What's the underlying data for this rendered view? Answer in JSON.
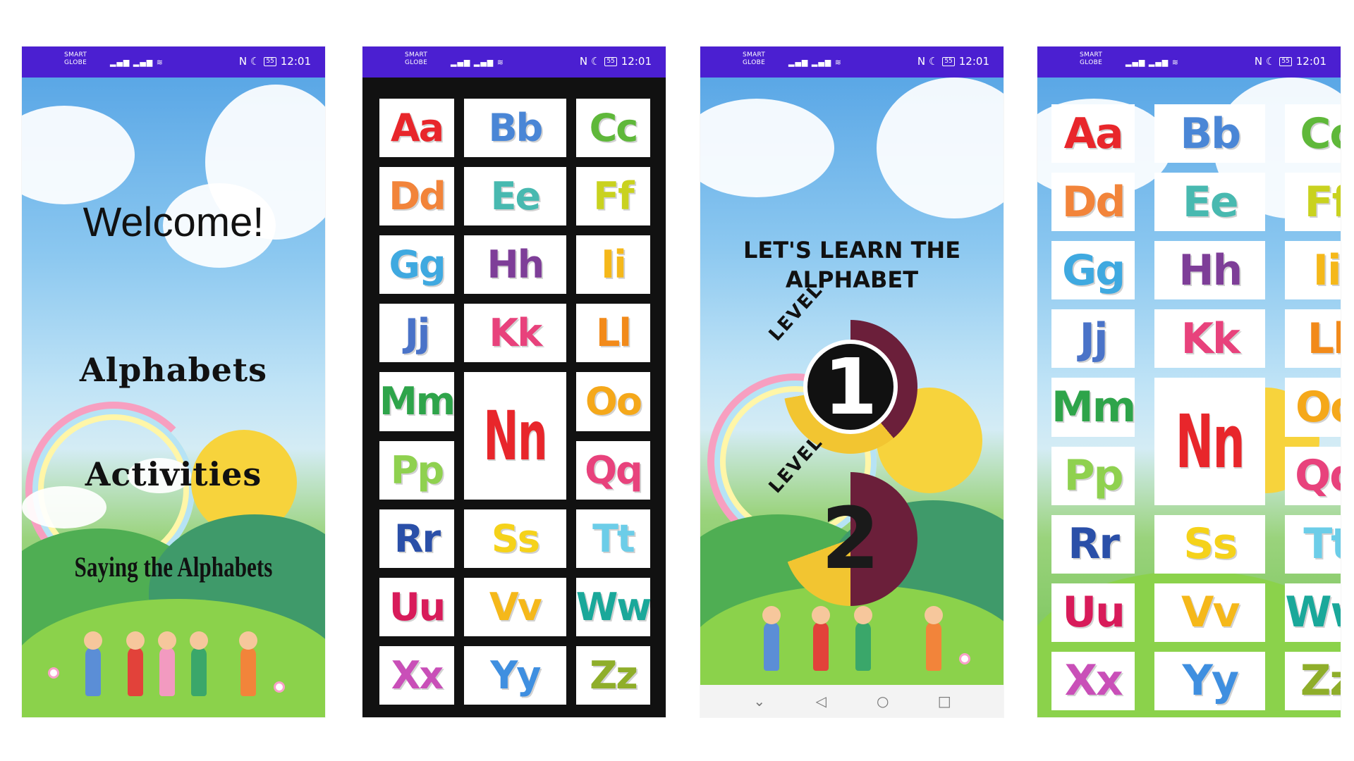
{
  "status_bar": {
    "carrier_line1": "SMART",
    "carrier_line2": "GLOBE",
    "signal": "▂▄▆ ▂▄▆ ≋",
    "icons": "N ☾",
    "battery": "55",
    "time": "12:01"
  },
  "screen1": {
    "welcome": "Welcome!",
    "menu": [
      "Alphabets",
      "Activities",
      "Saying the Alphabets"
    ]
  },
  "letters": [
    {
      "text": "Aa",
      "color": "#e8262b"
    },
    {
      "text": "Bb",
      "color": "#4a86d6"
    },
    {
      "text": "Cc",
      "color": "#5fb83a"
    },
    {
      "text": "Dd",
      "color": "#f2843a"
    },
    {
      "text": "Ee",
      "color": "#48b9b0"
    },
    {
      "text": "Ff",
      "color": "#c9d21f"
    },
    {
      "text": "Gg",
      "color": "#3fa9e0"
    },
    {
      "text": "Hh",
      "color": "#7e3e98"
    },
    {
      "text": "Ii",
      "color": "#f5b81a"
    },
    {
      "text": "Jj",
      "color": "#4a73c8"
    },
    {
      "text": "Kk",
      "color": "#e8427c"
    },
    {
      "text": "Ll",
      "color": "#f28a1a"
    },
    {
      "text": "Mm",
      "color": "#2ea44a"
    },
    {
      "text": "Nn",
      "color": "#e8262b"
    },
    {
      "text": "Oo",
      "color": "#f5a81a"
    },
    {
      "text": "Pp",
      "color": "#8fd14f"
    },
    {
      "text": "Qq",
      "color": "#e8427c"
    },
    {
      "text": "Rr",
      "color": "#2a4fa8"
    },
    {
      "text": "Ss",
      "color": "#f5d21a"
    },
    {
      "text": "Tt",
      "color": "#6ccde8"
    },
    {
      "text": "Uu",
      "color": "#d81b5a"
    },
    {
      "text": "Vv",
      "color": "#f5b81a"
    },
    {
      "text": "Ww",
      "color": "#1aa89a"
    },
    {
      "text": "Xx",
      "color": "#c94fb8"
    },
    {
      "text": "Yy",
      "color": "#3f8fe0"
    },
    {
      "text": "Zz",
      "color": "#8fae2a"
    }
  ],
  "screen3": {
    "title_line1": "LET'S LEARN THE",
    "title_line2": "ALPHABET",
    "levels": [
      {
        "word": "LEVEL",
        "number": "1"
      },
      {
        "word": "LEVEL",
        "number": "2"
      }
    ],
    "nav": {
      "hide": "⌄",
      "back": "◁",
      "home": "○",
      "recent": "□"
    }
  },
  "colors": {
    "status_bar": "#4b1fd1",
    "grid_background": "#111111",
    "level_yellow": "#f2c531",
    "level_maroon": "#6b1f3a"
  }
}
